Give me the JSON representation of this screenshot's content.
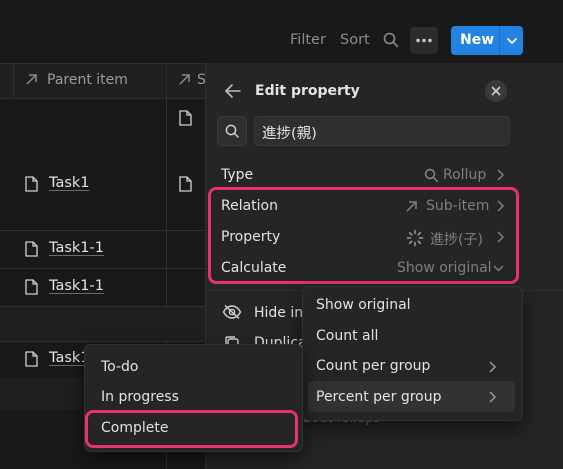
{
  "toolbar": {
    "filter_label": "Filter",
    "sort_label": "Sort",
    "new_label": "New"
  },
  "table": {
    "column_header": "Parent item",
    "column_header_partial": "S",
    "rows": [
      {
        "label": "Task1"
      },
      {
        "label": "Task1-1"
      },
      {
        "label": "Task1-1"
      },
      {
        "label": "Task1"
      }
    ]
  },
  "edit_property": {
    "title": "Edit property",
    "search_value": "進捗(親)",
    "type_label": "Type",
    "type_value": "Rollup",
    "relation_label": "Relation",
    "relation_value": "Sub-item",
    "property_label": "Property",
    "property_value": "進捗(子)",
    "calculate_label": "Calculate",
    "calculate_value": "Show original",
    "hide_label": "Hide in",
    "duplicate_label": "Duplica",
    "learn_more_label": "bout rollups"
  },
  "calculate_menu": {
    "items": [
      {
        "label": "Show original"
      },
      {
        "label": "Count all"
      },
      {
        "label": "Count per group"
      },
      {
        "label": "Percent per group"
      }
    ]
  },
  "group_submenu": {
    "items": [
      {
        "label": "To-do"
      },
      {
        "label": "In progress"
      },
      {
        "label": "Complete"
      }
    ]
  },
  "colors": {
    "accent": "#2383e2",
    "highlight": "#e5336b",
    "background": "#191919",
    "panel": "#252525"
  }
}
